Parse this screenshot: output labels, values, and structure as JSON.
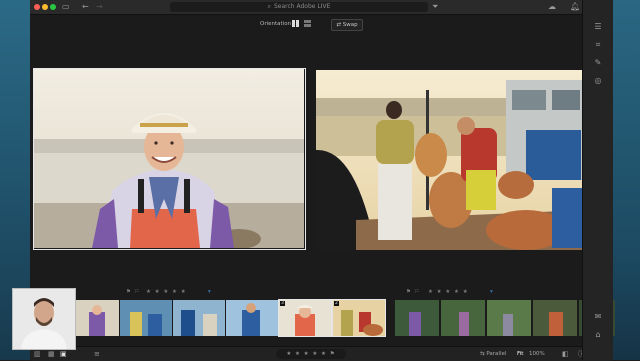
{
  "titlebar": {
    "search_placeholder": "Search Adobe LIVE"
  },
  "toolbar": {
    "orientation_label": "Orientation",
    "swap_label": "Swap"
  },
  "compare": {
    "left_photo": "woman-in-hat-portrait",
    "right_photo": "fishermen-on-boat"
  },
  "filmstrip": {
    "left_stars": "★ ★ ★ ★ ★",
    "right_stars": "★ ★ ★ ★ ★",
    "thumbs": [
      {
        "num": ""
      },
      {
        "num": ""
      },
      {
        "num": ""
      },
      {
        "num": ""
      },
      {
        "num": "3"
      },
      {
        "num": "2"
      },
      {
        "num": ""
      },
      {
        "num": ""
      },
      {
        "num": ""
      },
      {
        "num": ""
      },
      {
        "num": ""
      }
    ]
  },
  "bottombar": {
    "center_stars": "★ ★ ★ ★ ★",
    "parallel_label": "Parallel",
    "fit_label": "Fit",
    "zoom_label": "100%"
  },
  "colors": {
    "frame_blue": "#2b6a86",
    "app_bg": "#1b1b1b",
    "selection": "#e8e8e8"
  },
  "icons": [
    "back-arrow-icon",
    "forward-arrow-icon",
    "sidebar-icon",
    "filter-icon",
    "cloud-icon",
    "bell-icon",
    "gear-icon",
    "help-icon",
    "sliders-icon",
    "crop-icon",
    "brush-icon",
    "info-icon",
    "grid-icon",
    "square-icon",
    "sort-icon",
    "flag-icon"
  ]
}
